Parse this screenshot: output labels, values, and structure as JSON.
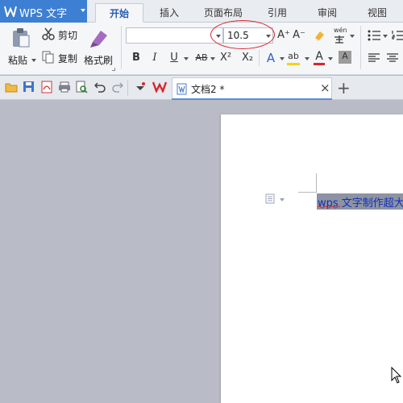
{
  "app": {
    "title": "WPS 文字",
    "brand_color": "#3d7fd2"
  },
  "menu_tabs": [
    {
      "label": "开始",
      "active": true
    },
    {
      "label": "插入",
      "active": false
    },
    {
      "label": "页面布局",
      "active": false
    },
    {
      "label": "引用",
      "active": false
    },
    {
      "label": "审阅",
      "active": false
    },
    {
      "label": "视图",
      "active": false
    }
  ],
  "ribbon": {
    "clipboard": {
      "paste_label": "粘贴",
      "cut_label": "剪切",
      "copy_label": "复制",
      "format_painter_label": "格式刷"
    },
    "font": {
      "font_name": "",
      "font_size": "10.5",
      "bold_label": "B",
      "italic_label": "I",
      "underline_label": "U",
      "strike_label": "AB",
      "superscript_label": "X²",
      "subscript_label": "X₂",
      "grow_label": "A⁺",
      "shrink_label": "A⁻",
      "phonetic_label": "wén",
      "effect_label": "A",
      "highlight_label": "ab",
      "font_color_label": "A",
      "shade_label": "A",
      "font_color": "#d7262c",
      "highlight_color": "#f2d21b"
    }
  },
  "quick_access": {
    "icons": [
      "open-icon",
      "save-icon",
      "export-pdf-icon",
      "print-icon",
      "print-preview-icon",
      "undo-icon",
      "redo-icon",
      "customize-icon",
      "wps-logo-icon"
    ]
  },
  "document_tab": {
    "name": "文档2 *",
    "close_label": "×",
    "new_tab_label": "+"
  },
  "document": {
    "text": "wps 文字制作超大字"
  },
  "annotation": {
    "circle_color": "#d7262c"
  }
}
